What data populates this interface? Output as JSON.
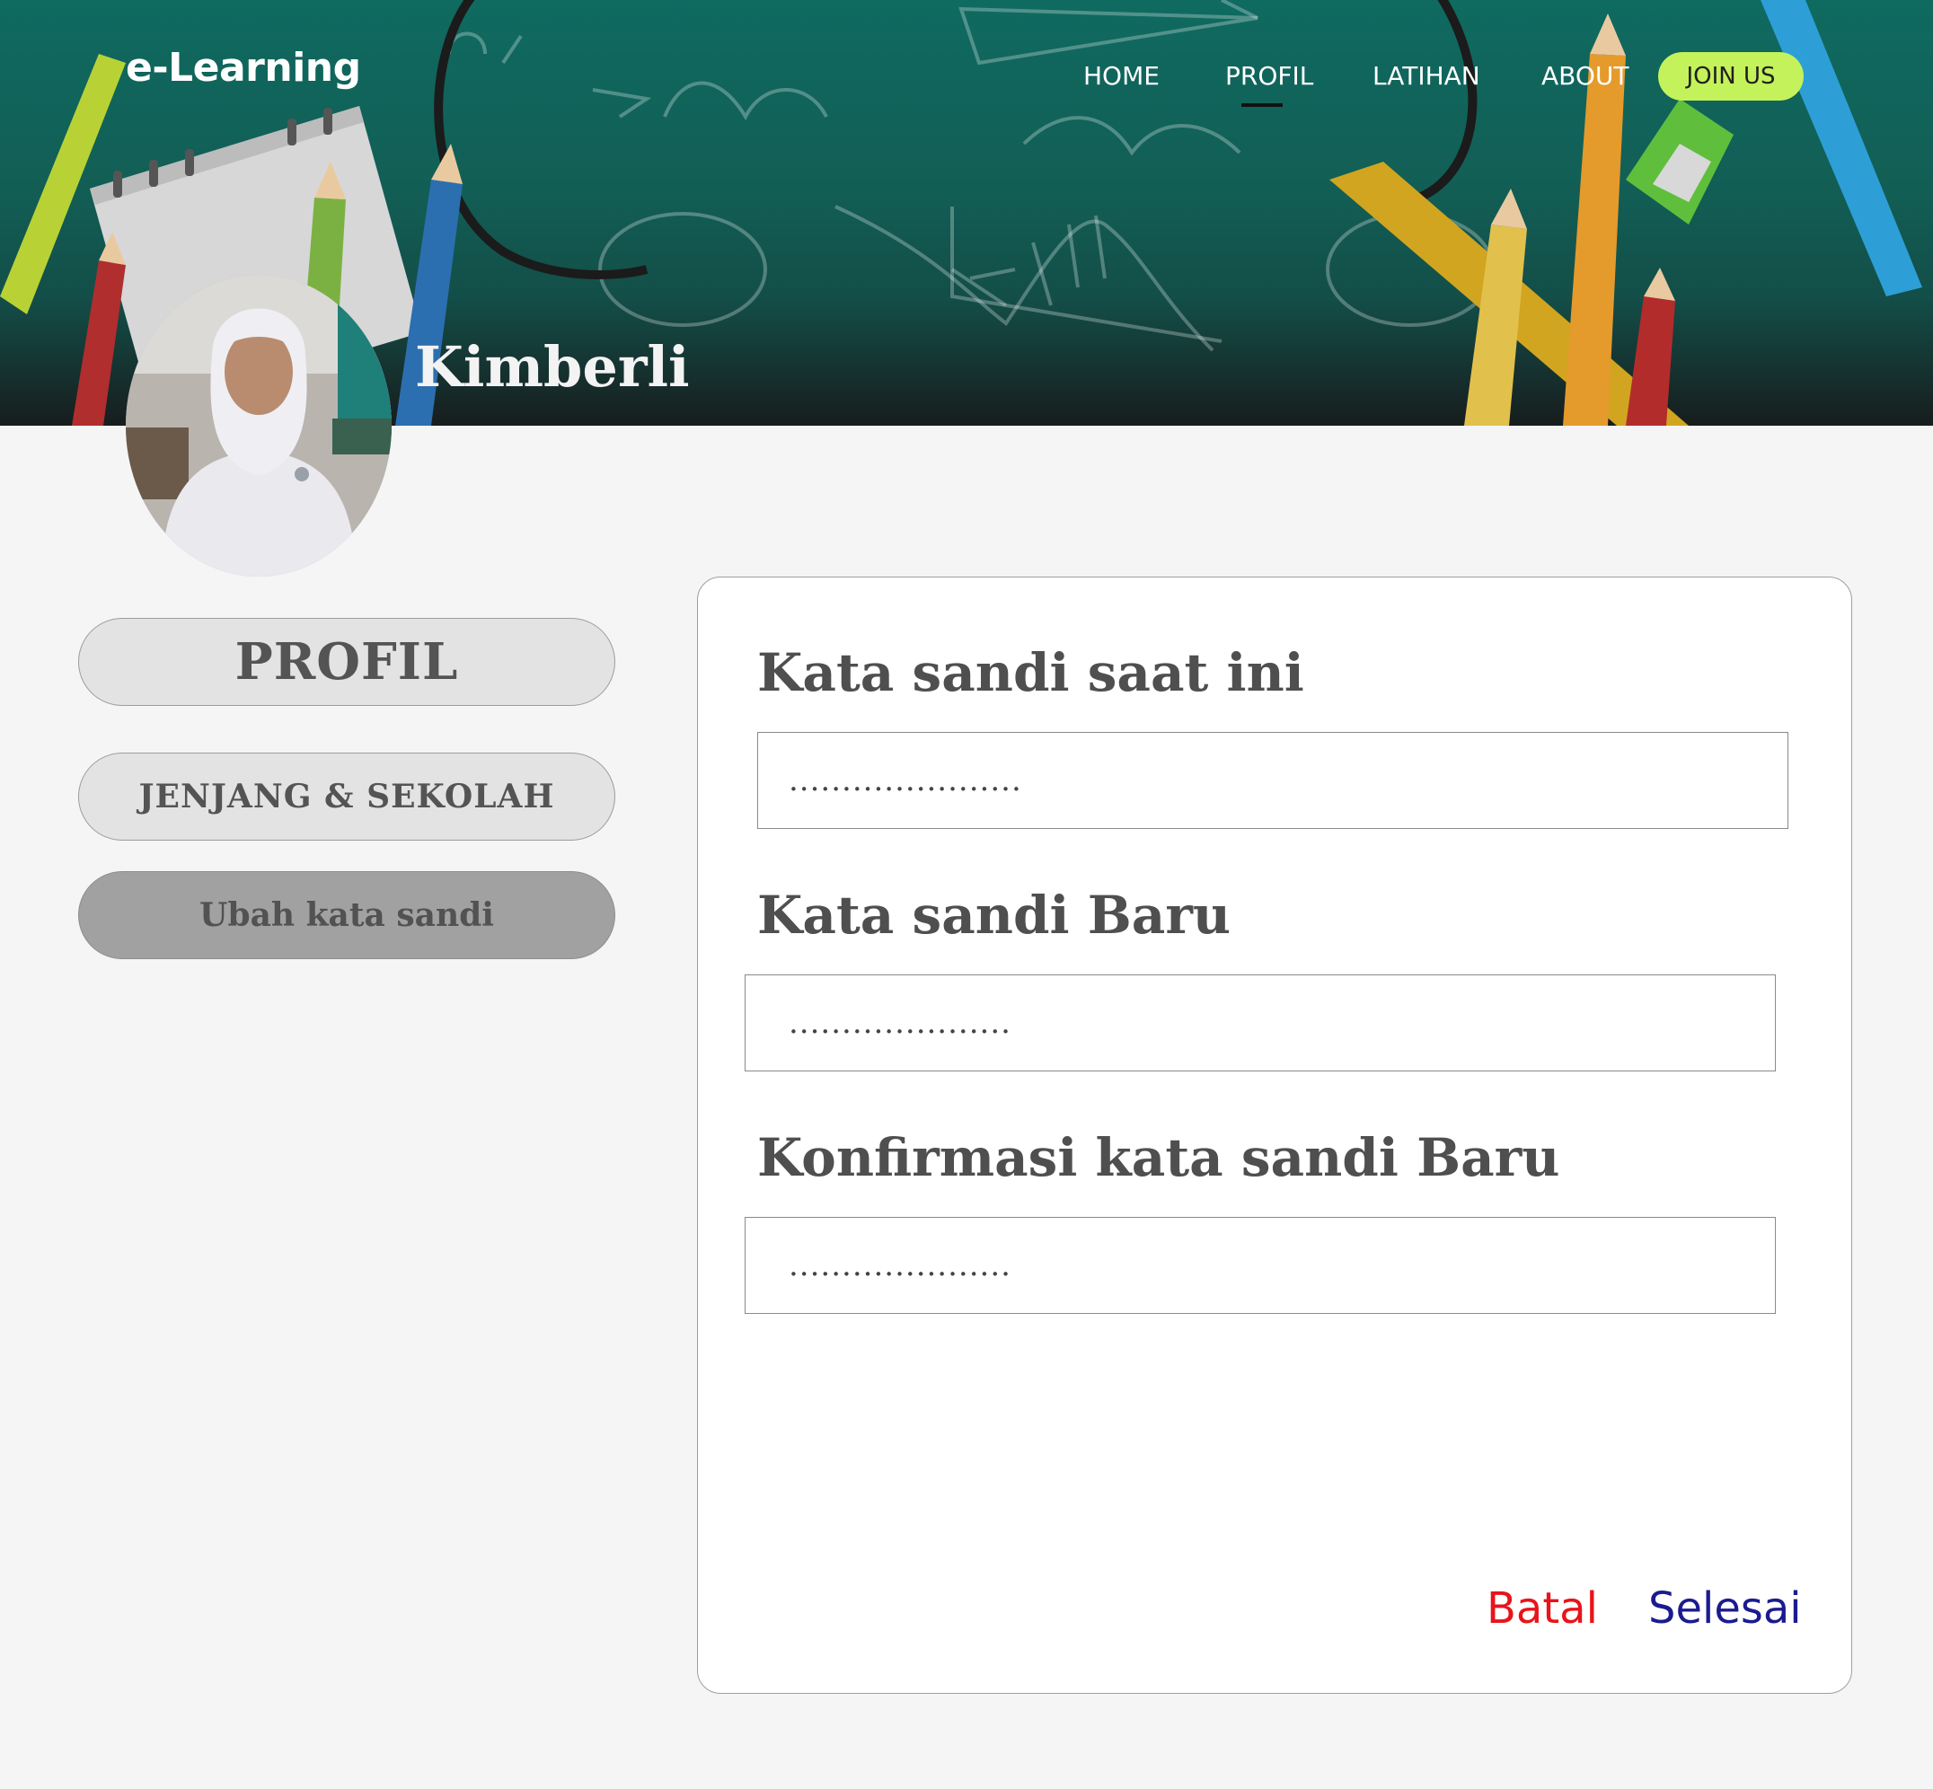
{
  "header": {
    "brand": "e-Learning",
    "nav": [
      {
        "label": "HOME"
      },
      {
        "label": "PROFIL",
        "active": true
      },
      {
        "label": "LATIHAN"
      },
      {
        "label": "ABOUT"
      }
    ],
    "join_label": "JOIN US",
    "profile_name": "Kimberli"
  },
  "sidebar": {
    "items": [
      {
        "label": "PROFIL"
      },
      {
        "label": "JENJANG & SEKOLAH"
      },
      {
        "label": "Ubah kata sandi",
        "active": true
      }
    ]
  },
  "form": {
    "fields": [
      {
        "label": "Kata sandi saat ini",
        "value": "......................"
      },
      {
        "label": "Kata sandi Baru",
        "value": "....................."
      },
      {
        "label": "Konfirmasi kata sandi Baru",
        "value": "....................."
      }
    ],
    "cancel_label": "Batal",
    "done_label": "Selesai"
  },
  "colors": {
    "header_green": "#0f6a60",
    "join_button": "#c4f25a",
    "cancel_text": "#e8141a",
    "done_text": "#1b1b8f",
    "page_background": "#f5f5f5"
  }
}
